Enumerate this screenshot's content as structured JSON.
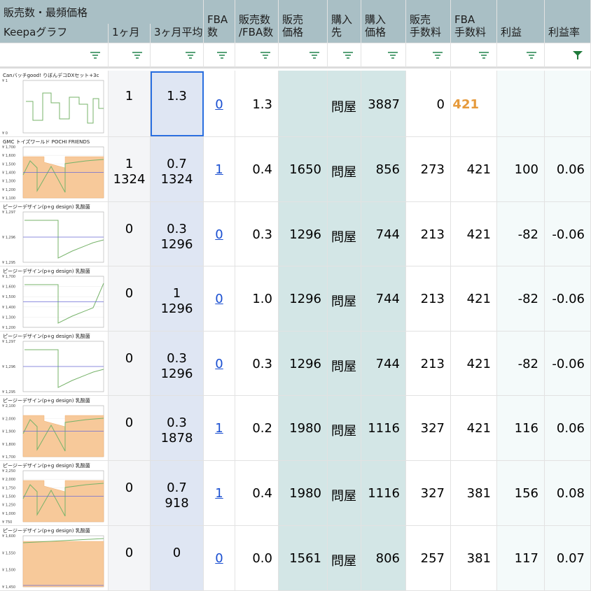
{
  "header": {
    "group1": "販売数・最頻価格",
    "keepa": "Keepaグラフ",
    "m1": "1ヶ月",
    "m3": "3ヶ月平均",
    "fba_count": "FBA\n数",
    "sales_fba": "販売数\n/FBA数",
    "price": "販売\n価格",
    "supplier": "購入\n先",
    "buy_price": "購入\n価格",
    "fee": "販売\n手数料",
    "fba_fee": "FBA\n手数料",
    "profit": "利益",
    "profit_rate": "利益率"
  },
  "colors": {
    "header": "#a9bfc5",
    "teal": "#d3e6e6",
    "blue": "#dfe6f3",
    "orange": "#e69a3b",
    "link": "#1a4fd1",
    "green_filter": "#1f7a3a"
  },
  "rows": [
    {
      "graph_title": "Canバッチgood! りぼんデコDXセット+3c",
      "m1": "1",
      "m3a": "1.3",
      "m3b": "",
      "fba": "0",
      "ratio": "1.3",
      "price": "",
      "supplier": "問屋",
      "buy": "3887",
      "fee": "0",
      "fbafee": "421",
      "profit": "",
      "rate": ""
    },
    {
      "graph_title": "GMC トイズワールド POCHI FRIENDS",
      "m1": "1",
      "m1b": "1324",
      "m3a": "0.7",
      "m3b": "1324",
      "fba": "1",
      "ratio": "0.4",
      "price": "1650",
      "supplier": "問屋",
      "buy": "856",
      "fee": "273",
      "fbafee": "421",
      "profit": "100",
      "rate": "0.06"
    },
    {
      "graph_title": "ピージーデザイン(p+g design) 乳酸菌",
      "m1": "0",
      "m1b": "",
      "m3a": "0.3",
      "m3b": "1296",
      "fba": "0",
      "ratio": "0.3",
      "price": "1296",
      "supplier": "問屋",
      "buy": "744",
      "fee": "213",
      "fbafee": "421",
      "profit": "-82",
      "rate": "-0.06"
    },
    {
      "graph_title": "ピージーデザイン(p+g design) 乳酸菌",
      "m1": "0",
      "m1b": "",
      "m3a": "1",
      "m3b": "1296",
      "fba": "0",
      "ratio": "1.0",
      "price": "1296",
      "supplier": "問屋",
      "buy": "744",
      "fee": "213",
      "fbafee": "421",
      "profit": "-82",
      "rate": "-0.06"
    },
    {
      "graph_title": "ピージーデザイン(p+g design) 乳酸菌",
      "m1": "0",
      "m1b": "",
      "m3a": "0.3",
      "m3b": "1296",
      "fba": "0",
      "ratio": "0.3",
      "price": "1296",
      "supplier": "問屋",
      "buy": "744",
      "fee": "213",
      "fbafee": "421",
      "profit": "-82",
      "rate": "-0.06"
    },
    {
      "graph_title": "ピージーデザイン(p+g design) 乳酸菌",
      "m1": "0",
      "m1b": "",
      "m3a": "0.3",
      "m3b": "1878",
      "fba": "1",
      "ratio": "0.2",
      "price": "1980",
      "supplier": "問屋",
      "buy": "1116",
      "fee": "327",
      "fbafee": "421",
      "profit": "116",
      "rate": "0.06"
    },
    {
      "graph_title": "ピージーデザイン(p+g design) 乳酸菌",
      "m1": "0",
      "m1b": "",
      "m3a": "0.7",
      "m3b": "918",
      "fba": "1",
      "ratio": "0.4",
      "price": "1980",
      "supplier": "問屋",
      "buy": "1116",
      "fee": "327",
      "fbafee": "381",
      "profit": "156",
      "rate": "0.08"
    },
    {
      "graph_title": "ピージーデザイン(p+g design) 乳酸菌",
      "m1": "0",
      "m1b": "",
      "m3a": "0",
      "m3b": "",
      "fba": "0",
      "ratio": "0.0",
      "price": "1561",
      "supplier": "問屋",
      "buy": "806",
      "fee": "257",
      "fbafee": "381",
      "profit": "117",
      "rate": "0.07"
    }
  ],
  "graph_labels": [
    [
      "¥ 1",
      "¥ 0"
    ],
    [
      "¥ 1,700",
      "¥ 1,600",
      "¥ 1,500",
      "¥ 1,400",
      "¥ 1,300",
      "¥ 1,200",
      "¥ 1,100"
    ],
    [
      "¥ 1,297",
      "¥ 1,296",
      "¥ 1,295"
    ],
    [
      "¥ 1,700",
      "¥ 1,600",
      "¥ 1,500",
      "¥ 1,400",
      "¥ 1,300",
      "¥ 1,200"
    ],
    [
      "¥ 1,297",
      "¥ 1,296",
      "¥ 1,295"
    ],
    [
      "¥ 2,100",
      "¥ 2,000",
      "¥ 1,900",
      "¥ 1,800",
      "¥ 1,700"
    ],
    [
      "¥ 2,250",
      "¥ 2,000",
      "¥ 1,750",
      "¥ 1,500",
      "¥ 1,250",
      "¥ 1,000",
      "¥ 750"
    ],
    [
      "¥ 1,600",
      "¥ 1,550",
      "¥ 1,500",
      "¥ 1,450"
    ]
  ]
}
